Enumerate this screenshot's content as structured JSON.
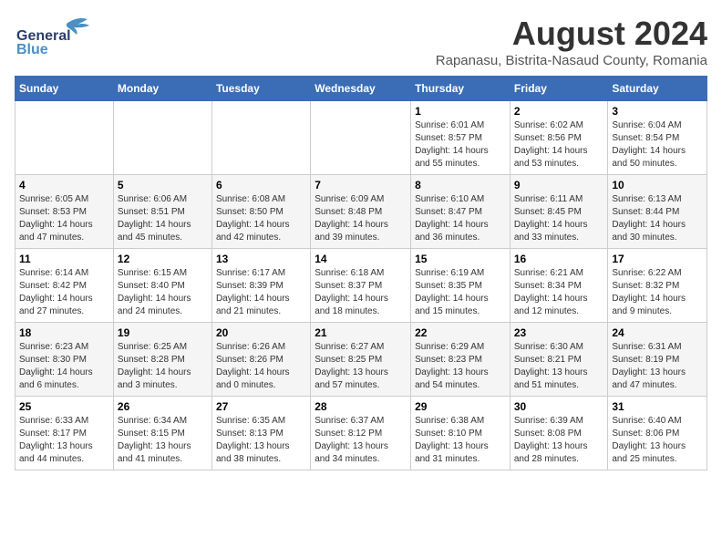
{
  "logo": {
    "general": "General",
    "blue": "Blue"
  },
  "title": {
    "month_year": "August 2024",
    "location": "Rapanasu, Bistrita-Nasaud County, Romania"
  },
  "days_of_week": [
    "Sunday",
    "Monday",
    "Tuesday",
    "Wednesday",
    "Thursday",
    "Friday",
    "Saturday"
  ],
  "weeks": [
    [
      {
        "day": "",
        "info": ""
      },
      {
        "day": "",
        "info": ""
      },
      {
        "day": "",
        "info": ""
      },
      {
        "day": "",
        "info": ""
      },
      {
        "day": "1",
        "info": "Sunrise: 6:01 AM\nSunset: 8:57 PM\nDaylight: 14 hours\nand 55 minutes."
      },
      {
        "day": "2",
        "info": "Sunrise: 6:02 AM\nSunset: 8:56 PM\nDaylight: 14 hours\nand 53 minutes."
      },
      {
        "day": "3",
        "info": "Sunrise: 6:04 AM\nSunset: 8:54 PM\nDaylight: 14 hours\nand 50 minutes."
      }
    ],
    [
      {
        "day": "4",
        "info": "Sunrise: 6:05 AM\nSunset: 8:53 PM\nDaylight: 14 hours\nand 47 minutes."
      },
      {
        "day": "5",
        "info": "Sunrise: 6:06 AM\nSunset: 8:51 PM\nDaylight: 14 hours\nand 45 minutes."
      },
      {
        "day": "6",
        "info": "Sunrise: 6:08 AM\nSunset: 8:50 PM\nDaylight: 14 hours\nand 42 minutes."
      },
      {
        "day": "7",
        "info": "Sunrise: 6:09 AM\nSunset: 8:48 PM\nDaylight: 14 hours\nand 39 minutes."
      },
      {
        "day": "8",
        "info": "Sunrise: 6:10 AM\nSunset: 8:47 PM\nDaylight: 14 hours\nand 36 minutes."
      },
      {
        "day": "9",
        "info": "Sunrise: 6:11 AM\nSunset: 8:45 PM\nDaylight: 14 hours\nand 33 minutes."
      },
      {
        "day": "10",
        "info": "Sunrise: 6:13 AM\nSunset: 8:44 PM\nDaylight: 14 hours\nand 30 minutes."
      }
    ],
    [
      {
        "day": "11",
        "info": "Sunrise: 6:14 AM\nSunset: 8:42 PM\nDaylight: 14 hours\nand 27 minutes."
      },
      {
        "day": "12",
        "info": "Sunrise: 6:15 AM\nSunset: 8:40 PM\nDaylight: 14 hours\nand 24 minutes."
      },
      {
        "day": "13",
        "info": "Sunrise: 6:17 AM\nSunset: 8:39 PM\nDaylight: 14 hours\nand 21 minutes."
      },
      {
        "day": "14",
        "info": "Sunrise: 6:18 AM\nSunset: 8:37 PM\nDaylight: 14 hours\nand 18 minutes."
      },
      {
        "day": "15",
        "info": "Sunrise: 6:19 AM\nSunset: 8:35 PM\nDaylight: 14 hours\nand 15 minutes."
      },
      {
        "day": "16",
        "info": "Sunrise: 6:21 AM\nSunset: 8:34 PM\nDaylight: 14 hours\nand 12 minutes."
      },
      {
        "day": "17",
        "info": "Sunrise: 6:22 AM\nSunset: 8:32 PM\nDaylight: 14 hours\nand 9 minutes."
      }
    ],
    [
      {
        "day": "18",
        "info": "Sunrise: 6:23 AM\nSunset: 8:30 PM\nDaylight: 14 hours\nand 6 minutes."
      },
      {
        "day": "19",
        "info": "Sunrise: 6:25 AM\nSunset: 8:28 PM\nDaylight: 14 hours\nand 3 minutes."
      },
      {
        "day": "20",
        "info": "Sunrise: 6:26 AM\nSunset: 8:26 PM\nDaylight: 14 hours\nand 0 minutes."
      },
      {
        "day": "21",
        "info": "Sunrise: 6:27 AM\nSunset: 8:25 PM\nDaylight: 13 hours\nand 57 minutes."
      },
      {
        "day": "22",
        "info": "Sunrise: 6:29 AM\nSunset: 8:23 PM\nDaylight: 13 hours\nand 54 minutes."
      },
      {
        "day": "23",
        "info": "Sunrise: 6:30 AM\nSunset: 8:21 PM\nDaylight: 13 hours\nand 51 minutes."
      },
      {
        "day": "24",
        "info": "Sunrise: 6:31 AM\nSunset: 8:19 PM\nDaylight: 13 hours\nand 47 minutes."
      }
    ],
    [
      {
        "day": "25",
        "info": "Sunrise: 6:33 AM\nSunset: 8:17 PM\nDaylight: 13 hours\nand 44 minutes."
      },
      {
        "day": "26",
        "info": "Sunrise: 6:34 AM\nSunset: 8:15 PM\nDaylight: 13 hours\nand 41 minutes."
      },
      {
        "day": "27",
        "info": "Sunrise: 6:35 AM\nSunset: 8:13 PM\nDaylight: 13 hours\nand 38 minutes."
      },
      {
        "day": "28",
        "info": "Sunrise: 6:37 AM\nSunset: 8:12 PM\nDaylight: 13 hours\nand 34 minutes."
      },
      {
        "day": "29",
        "info": "Sunrise: 6:38 AM\nSunset: 8:10 PM\nDaylight: 13 hours\nand 31 minutes."
      },
      {
        "day": "30",
        "info": "Sunrise: 6:39 AM\nSunset: 8:08 PM\nDaylight: 13 hours\nand 28 minutes."
      },
      {
        "day": "31",
        "info": "Sunrise: 6:40 AM\nSunset: 8:06 PM\nDaylight: 13 hours\nand 25 minutes."
      }
    ]
  ]
}
